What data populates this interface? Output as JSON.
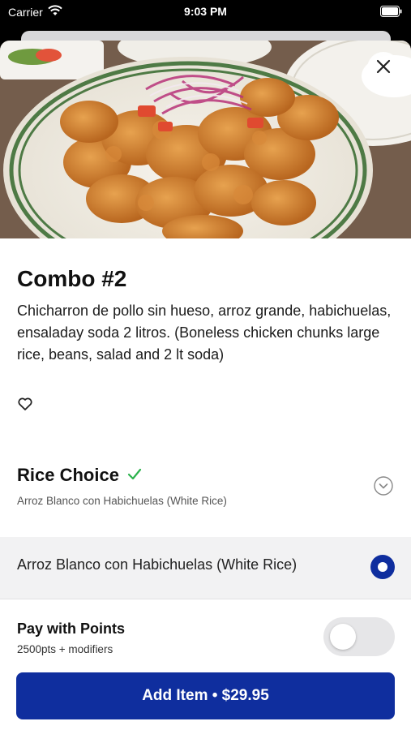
{
  "status_bar": {
    "carrier": "Carrier",
    "time": "9:03 PM"
  },
  "item": {
    "title": "Combo #2",
    "description": "Chicharron de pollo sin hueso, arroz grande, habichuelas, ensaladay soda 2 litros. (Boneless chicken chunks large rice, beans, salad and 2 lt soda)"
  },
  "rice_choice": {
    "title": "Rice Choice",
    "selected_summary": "Arroz Blanco con Habichuelas (White Rice)",
    "options": [
      {
        "label": "Arroz Blanco con Habichuelas (White Rice)",
        "selected": true
      }
    ]
  },
  "points": {
    "title": "Pay with Points",
    "subtitle": "2500pts + modifiers",
    "enabled": false
  },
  "cta": {
    "label": "Add Item • $29.95"
  },
  "colors": {
    "brand_blue": "#0f2e9e",
    "check_green": "#2bb24c"
  },
  "icons": [
    "wifi-icon",
    "battery-icon",
    "close-icon",
    "heart-icon",
    "check-icon",
    "chevron-down-icon"
  ]
}
